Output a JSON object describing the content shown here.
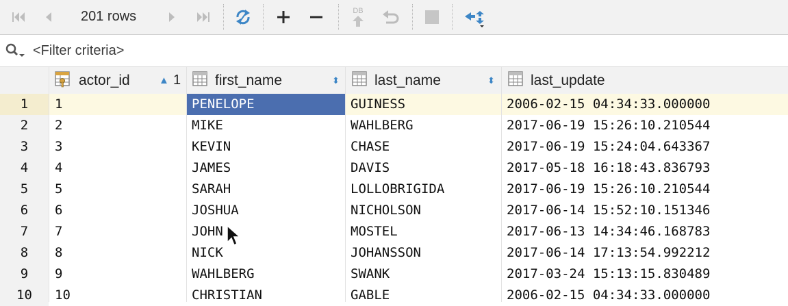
{
  "toolbar": {
    "rows_label": "201 rows",
    "db_label": "DB",
    "icons": [
      "first-page-icon",
      "prev-page-icon",
      "next-page-icon",
      "last-page-icon",
      "refresh-icon",
      "add-row-icon",
      "delete-row-icon",
      "submit-icon",
      "revert-icon",
      "stop-icon",
      "compare-icon"
    ]
  },
  "filter": {
    "placeholder": "<Filter criteria>"
  },
  "columns": [
    {
      "name": "actor_id",
      "sort": "▲",
      "sort_order": "1"
    },
    {
      "name": "first_name",
      "sort": "⬍"
    },
    {
      "name": "last_name",
      "sort": "⬍"
    },
    {
      "name": "last_update"
    }
  ],
  "rows": [
    {
      "n": "1",
      "actor_id": "1",
      "first_name": "PENELOPE",
      "last_name": "GUINESS",
      "last_update": "2006-02-15 04:34:33.000000"
    },
    {
      "n": "2",
      "actor_id": "2",
      "first_name": "MIKE",
      "last_name": "WAHLBERG",
      "last_update": "2017-06-19 15:26:10.210544"
    },
    {
      "n": "3",
      "actor_id": "3",
      "first_name": "KEVIN",
      "last_name": "CHASE",
      "last_update": "2017-06-19 15:24:04.643367"
    },
    {
      "n": "4",
      "actor_id": "4",
      "first_name": "JAMES",
      "last_name": "DAVIS",
      "last_update": "2017-05-18 16:18:43.836793"
    },
    {
      "n": "5",
      "actor_id": "5",
      "first_name": "SARAH",
      "last_name": "LOLLOBRIGIDA",
      "last_update": "2017-06-19 15:26:10.210544"
    },
    {
      "n": "6",
      "actor_id": "6",
      "first_name": "JOSHUA",
      "last_name": "NICHOLSON",
      "last_update": "2017-06-14 15:52:10.151346"
    },
    {
      "n": "7",
      "actor_id": "7",
      "first_name": "JOHN",
      "last_name": "MOSTEL",
      "last_update": "2017-06-13 14:34:46.168783"
    },
    {
      "n": "8",
      "actor_id": "8",
      "first_name": "NICK",
      "last_name": "JOHANSSON",
      "last_update": "2017-06-14 17:13:54.992212"
    },
    {
      "n": "9",
      "actor_id": "9",
      "first_name": "WAHLBERG",
      "last_name": "SWANK",
      "last_update": "2017-03-24 15:13:15.830489"
    },
    {
      "n": "10",
      "actor_id": "10",
      "first_name": "CHRISTIAN",
      "last_name": "GABLE",
      "last_update": "2006-02-15 04:34:33.000000"
    }
  ],
  "colors": {
    "selection": "#4b6eaf",
    "current_row": "#fdf9e2",
    "accent": "#3d86c6"
  }
}
